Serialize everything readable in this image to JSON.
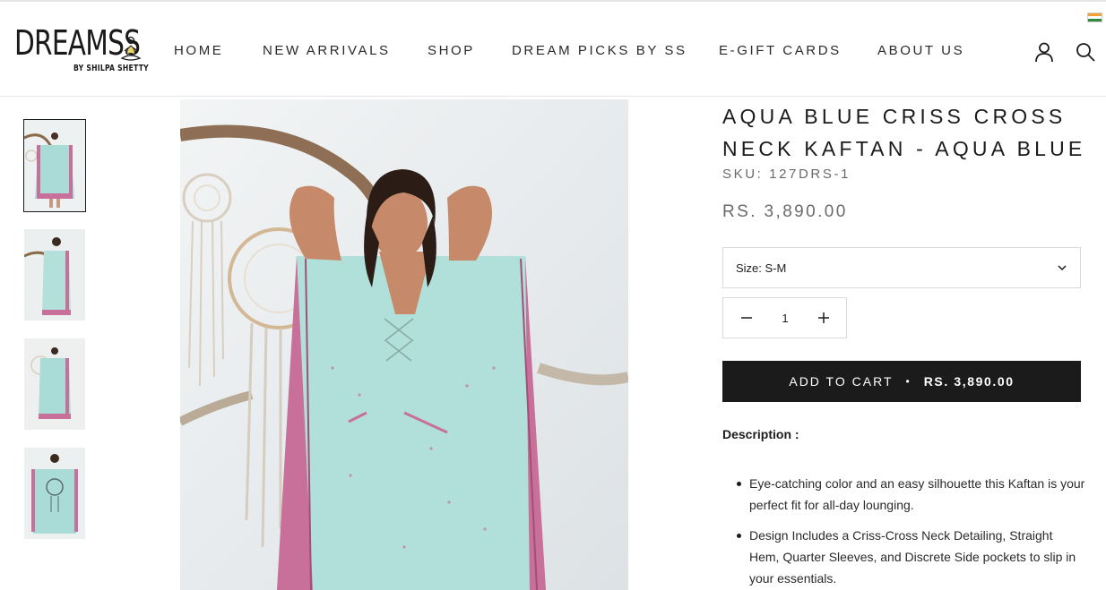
{
  "header": {
    "logo_text": "DREAMSS",
    "logo_subtext": "BY SHILPA SHETTY",
    "nav": [
      "HOME",
      "NEW ARRIVALS",
      "SHOP",
      "DREAM PICKS BY SS",
      "E-GIFT CARDS",
      "ABOUT US"
    ],
    "icons": [
      "account-icon",
      "search-icon",
      "india-flag-icon"
    ]
  },
  "gallery": {
    "thumbnail_count": 4,
    "active_index": 0
  },
  "product": {
    "title": "AQUA BLUE CRISS CROSS NECK KAFTAN - AQUA BLUE",
    "sku": "SKU: 127DRS-1",
    "price": "RS. 3,890.00",
    "size_select": "Size: S-M",
    "quantity": "1",
    "add_to_cart": "ADD TO CART",
    "add_to_cart_price": "RS. 3,890.00",
    "description_heading": "Description :",
    "description_items": [
      "Eye-catching color and an easy silhouette this Kaftan is your perfect fit for all-day lounging.",
      "Design Includes a Criss-Cross Neck Detailing, Straight Hem, Quarter Sleeves, and Discrete Side pockets to slip in your essentials."
    ]
  },
  "colors": {
    "accent_dark": "#1c1b1b",
    "muted_text": "#6a6a6a",
    "kaftan_aqua": "#a9dcd6",
    "kaftan_border_pink": "#c8709a"
  }
}
